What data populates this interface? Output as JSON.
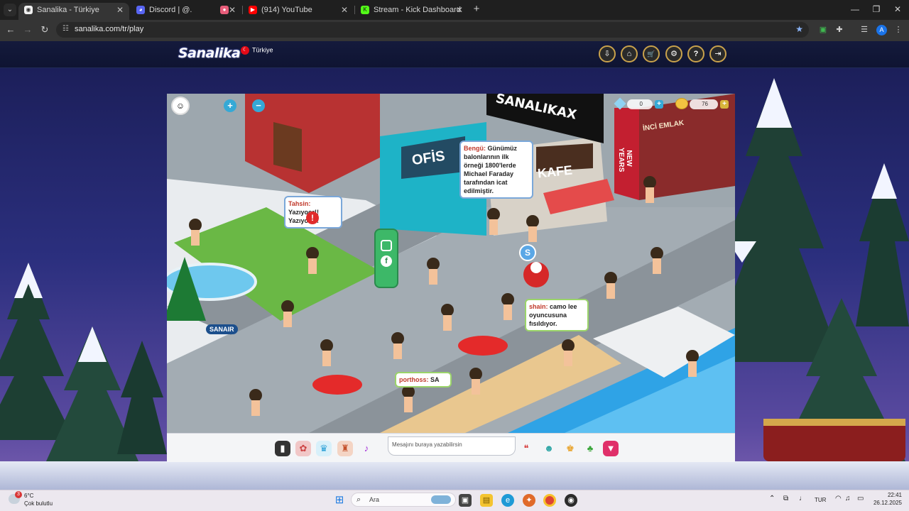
{
  "browser": {
    "tabs": [
      {
        "title": "Sanalika - Türkiye",
        "icon": "sanalika-favicon",
        "active": true
      },
      {
        "title": "Discord | @.",
        "icon": "discord-favicon",
        "active": false
      },
      {
        "title": "(914) YouTube",
        "icon": "youtube-favicon",
        "active": false
      },
      {
        "title": "Stream - Kick Dashboard",
        "icon": "kick-favicon",
        "active": false
      }
    ],
    "url": "sanalika.com/tr/play",
    "profile_initial": "A"
  },
  "site": {
    "logo": "Sanalika",
    "country": "Türkiye",
    "header_buttons": [
      "download-icon",
      "home-icon",
      "cart-icon",
      "settings-icon",
      "help-icon",
      "logout-icon"
    ],
    "header_glyphs": [
      "⇩",
      "⌂",
      "🛒",
      "⚙",
      "?",
      "⇥"
    ]
  },
  "game": {
    "hud": {
      "diamonds": "0",
      "coins": "76"
    },
    "signs": {
      "sanalikax": "SANALIKAX",
      "ofis": "OFİS",
      "kafe": "KAFE",
      "emlak": "İNCİ EMLAK",
      "new_years": "NEW YEARS",
      "sanair": "SANAIR"
    },
    "bubbles": [
      {
        "name": "Bengü:",
        "text": "Günümüz balonlarının ilk örneği 1800'lerde Michael Faraday tarafından icat edilmiştir."
      },
      {
        "name": "Tahsin:",
        "text": "Yazıyoor!! Yazıyoor!!"
      },
      {
        "name": "shain:",
        "text": "camo lee oyuncusuna fısıldıyor."
      },
      {
        "name": "porthoss:",
        "text": "SA"
      }
    ]
  },
  "chatbar": {
    "placeholder": "Mesajını buraya yazabilirsin",
    "left_tools": [
      "phone-icon",
      "emote-icon",
      "outfit-icon",
      "bag-icon",
      "dance-icon"
    ],
    "right_tools": [
      "chat-icon",
      "pet-icon",
      "trophy-icon",
      "island-icon",
      "gem-shop-icon"
    ]
  },
  "taskbar": {
    "weather_temp": "6°C",
    "weather_desc": "Çok bulutlu",
    "weather_badge": "3",
    "search_text": "Ara",
    "language": "TUR",
    "time": "22:41",
    "date": "26.12.2025"
  }
}
